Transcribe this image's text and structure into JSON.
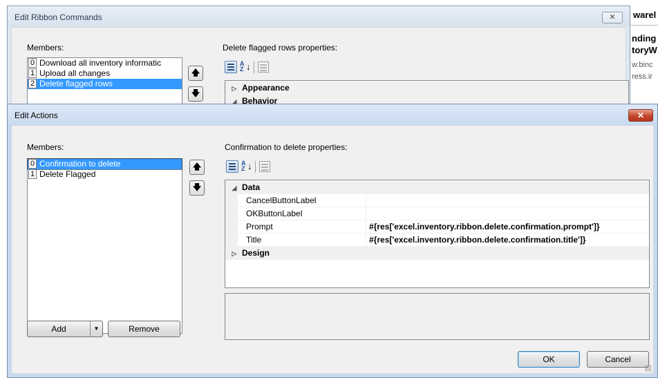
{
  "background_doc": {
    "line1": "warel",
    "line2": "nding",
    "line3": "toryW",
    "line4": "w.binc",
    "line5": "ress.ir"
  },
  "ribbon_dialog": {
    "title": "Edit Ribbon Commands",
    "close_glyph": "✕",
    "members_label": "Members:",
    "members": [
      {
        "index": "0",
        "label": "Download all inventory informatic"
      },
      {
        "index": "1",
        "label": "Upload all changes"
      },
      {
        "index": "2",
        "label": "Delete flagged rows"
      }
    ],
    "selected_index": 2,
    "properties_label": "Delete flagged rows properties:",
    "categories": [
      {
        "glyph": "▷",
        "name": "Appearance"
      },
      {
        "glyph": "◢",
        "name": "Behavior"
      }
    ],
    "up_glyph": "🡅",
    "down_glyph": "🡇"
  },
  "actions_dialog": {
    "title": "Edit Actions",
    "close_glyph": "✕",
    "members_label": "Members:",
    "members": [
      {
        "index": "0",
        "label": "Confirmation to delete"
      },
      {
        "index": "1",
        "label": "Delete Flagged"
      }
    ],
    "selected_index": 0,
    "properties_label": "Confirmation to delete properties:",
    "grid": {
      "data_category": {
        "glyph": "◢",
        "name": "Data"
      },
      "properties": [
        {
          "name": "CancelButtonLabel",
          "value": ""
        },
        {
          "name": "OKButtonLabel",
          "value": ""
        },
        {
          "name": "Prompt",
          "value": "#{res['excel.inventory.ribbon.delete.confirmation.prompt']}"
        },
        {
          "name": "Title",
          "value": "#{res['excel.inventory.ribbon.delete.confirmation.title']}"
        }
      ],
      "design_category": {
        "glyph": "▷",
        "name": "Design"
      }
    },
    "add_label": "Add",
    "add_arrow": "▼",
    "remove_label": "Remove",
    "ok_label": "OK",
    "cancel_label": "Cancel",
    "up_glyph": "🡅",
    "down_glyph": "🡇"
  },
  "toolbar_icons": [
    "categorized-icon",
    "alphabetical-sort-icon",
    "property-pages-icon"
  ]
}
